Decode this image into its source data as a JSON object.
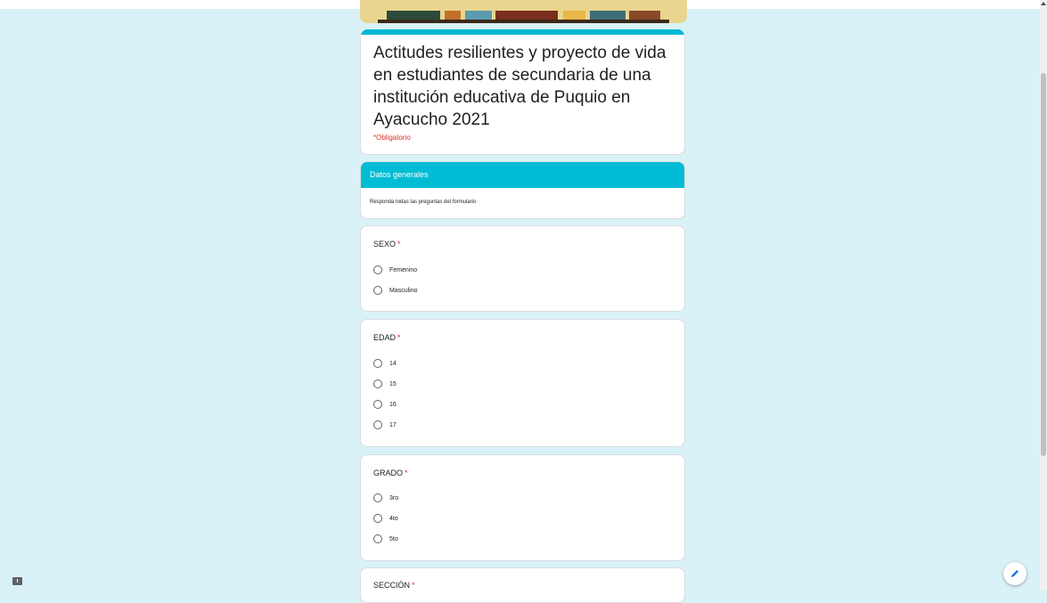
{
  "form": {
    "title": "Actitudes resilientes y proyecto de vida en estudiantes de secundaria de una institución educativa de Puquio en Ayacucho 2021",
    "required_note": "*Obligatorio"
  },
  "section": {
    "title": "Datos generales",
    "description": "Responda todas las preguntas del formulario"
  },
  "questions": [
    {
      "title": "SEXO",
      "required_mark": "*",
      "options": [
        "Femenino",
        "Masculino"
      ]
    },
    {
      "title": "EDAD",
      "required_mark": "*",
      "options": [
        "14",
        "15",
        "16",
        "17"
      ]
    },
    {
      "title": "GRADO",
      "required_mark": "*",
      "options": [
        "3ro",
        "4to",
        "5to"
      ]
    },
    {
      "title": "SECCIÓN",
      "required_mark": "*",
      "options": []
    }
  ],
  "colors": {
    "background": "#d9f2f7",
    "accent": "#00bcd4",
    "required": "#d93025"
  },
  "icons": [
    "feedback-icon",
    "pencil-icon"
  ]
}
